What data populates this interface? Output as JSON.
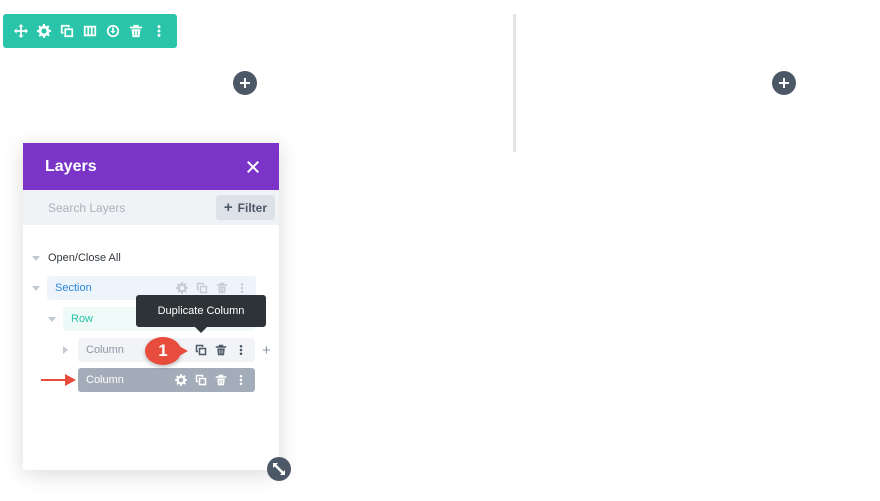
{
  "toolbar": {
    "icons": [
      "move-icon",
      "gear-icon",
      "duplicate-icon",
      "columns-icon",
      "save-icon",
      "trash-icon",
      "more-icon"
    ],
    "color": "#29c4a9"
  },
  "layers": {
    "title": "Layers",
    "search_placeholder": "Search Layers",
    "filter_label": "Filter",
    "open_close_label": "Open/Close All",
    "header_color": "#7a35c8",
    "tree": {
      "section": "Section",
      "row": "Row",
      "column_1": "Column",
      "column_2": "Column"
    }
  },
  "tooltip": "Duplicate Column",
  "step_badge": "1",
  "colors": {
    "section_text": "#2b87da",
    "row_text": "#29c4a9",
    "column_text": "#8a96a3",
    "selected_bg": "#a3acb9",
    "badge": "#e74c3c"
  }
}
